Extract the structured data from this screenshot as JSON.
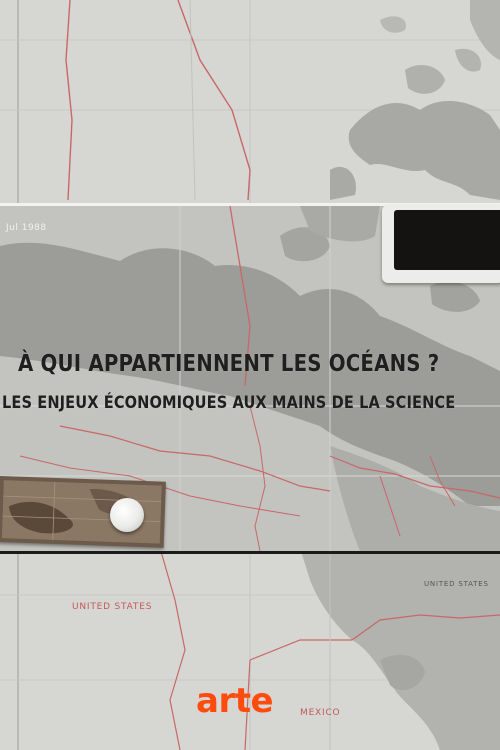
{
  "poster": {
    "title_line_1": "À QUI APPARTIENNENT LES OCÉANS ?",
    "title_line_2": "LES ENJEUX ÉCONOMIQUES AUX MAINS DE LA SCIENCE",
    "network_logo": "arte"
  },
  "map_labels": {
    "united_states": "UNITED STATES",
    "mexico": "MEXICO",
    "united_states_small": "UNITED STATES",
    "corner_tag": "Jul 1988"
  },
  "colors": {
    "logo": "#ff4c0c",
    "map_paper": "#d6d6d2",
    "map_lines": "#c86868",
    "title_text": "#1f1f1f"
  }
}
